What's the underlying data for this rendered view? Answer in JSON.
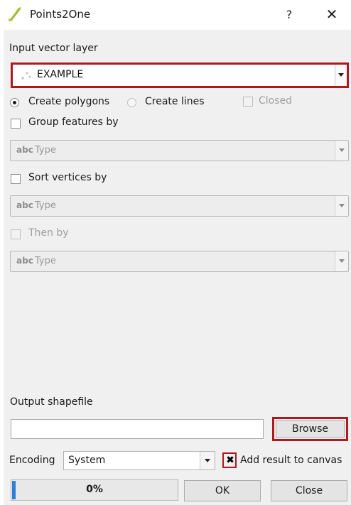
{
  "window": {
    "title": "Points2One",
    "help_label": "?",
    "close_label": "✕"
  },
  "input_layer": {
    "label": "Input vector layer",
    "value": "EXAMPLE"
  },
  "geometry": {
    "create_polygons": {
      "label": "Create polygons",
      "selected": true
    },
    "create_lines": {
      "label": "Create lines",
      "selected": false
    },
    "closed": {
      "label": "Closed",
      "checked": false,
      "enabled": false
    }
  },
  "group": {
    "label": "Group features by",
    "checked": false,
    "field": {
      "type_tag": "abc",
      "value": "Type"
    }
  },
  "sort": {
    "label": "Sort vertices by",
    "checked": false,
    "field": {
      "type_tag": "abc",
      "value": "Type"
    }
  },
  "then_by": {
    "label": "Then by",
    "checked": false,
    "enabled": false,
    "field": {
      "type_tag": "abc",
      "value": "Type"
    }
  },
  "output": {
    "label": "Output shapefile",
    "value": "",
    "browse_label": "Browse"
  },
  "encoding": {
    "label": "Encoding",
    "value": "System"
  },
  "add_to_canvas": {
    "label": "Add result to canvas",
    "checked": true,
    "mark": "✖"
  },
  "progress": {
    "value": 0.02,
    "text": "0%"
  },
  "buttons": {
    "ok": "OK",
    "close": "Close"
  },
  "colors": {
    "highlight": "#b01820",
    "progress_fill": "#2f7fd8"
  }
}
